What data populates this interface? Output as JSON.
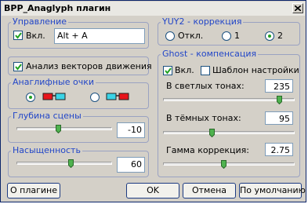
{
  "window": {
    "title": "BPP_Anaglyph плагин"
  },
  "management": {
    "group_label": "Управление",
    "enable_label": "Вкл.",
    "enable_checked": true,
    "hotkey_value": "Alt + A"
  },
  "motion": {
    "label": "Анализ векторов движения",
    "checked": true
  },
  "glasses": {
    "group_label": "Анаглифные очки",
    "options": [
      {
        "name": "red-cyan",
        "selected": true,
        "left_color": "#e8141b",
        "right_color": "#3ad3e6"
      },
      {
        "name": "cyan-red",
        "selected": false,
        "left_color": "#3ad3e6",
        "right_color": "#e8141b"
      }
    ]
  },
  "depth": {
    "group_label": "Глубина сцены",
    "value": "-10"
  },
  "saturation": {
    "group_label": "Насыщенность",
    "value": "60"
  },
  "yuy2": {
    "group_label": "YUY2 - коррекция",
    "options": [
      {
        "label": "Откл.",
        "selected": false
      },
      {
        "label": "1",
        "selected": false
      },
      {
        "label": "2",
        "selected": true
      }
    ]
  },
  "ghost": {
    "group_label": "Ghost - компенсация",
    "enable_label": "Вкл.",
    "enable_checked": true,
    "template_label": "Шаблон настройки",
    "template_checked": false,
    "light_label": "В светлых тонах:",
    "light_value": "235",
    "dark_label": "В тёмных тонах:",
    "dark_value": "95",
    "gamma_label": "Гамма коррекция:",
    "gamma_value": "2.75"
  },
  "buttons": {
    "about": "О плагине",
    "ok": "OK",
    "cancel": "Отмена",
    "default": "По умолчанию"
  },
  "colors": {
    "group_label": "#2246c8",
    "check_mark": "#21a121",
    "radio_dot": "#21a121",
    "thumb_fill": "#4fb24f"
  }
}
